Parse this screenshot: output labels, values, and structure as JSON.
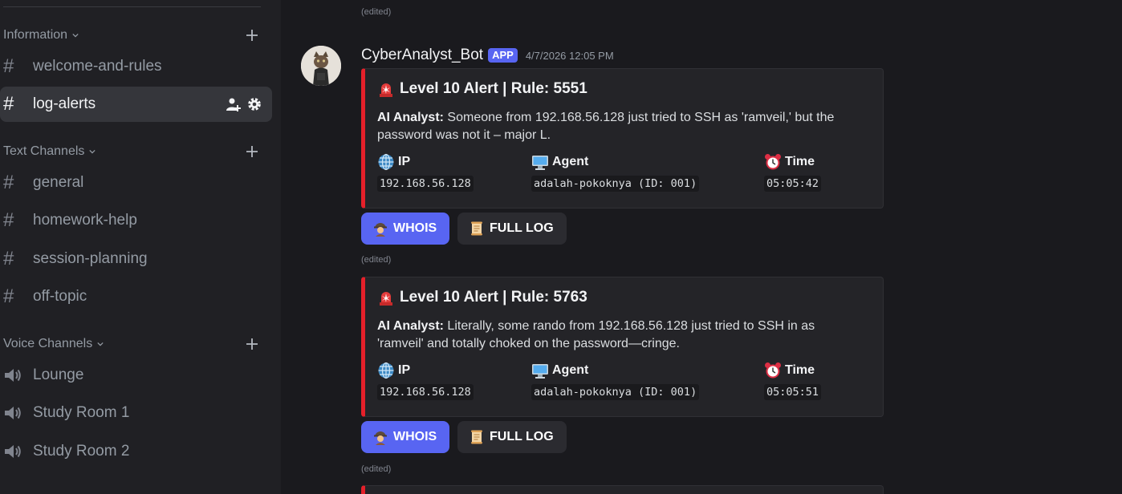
{
  "sidebar": {
    "categories": [
      {
        "label": "Information"
      },
      {
        "label": "Text Channels"
      },
      {
        "label": "Voice Channels"
      }
    ],
    "channels": [
      {
        "label": "welcome-and-rules"
      },
      {
        "label": "log-alerts"
      },
      {
        "label": "general"
      },
      {
        "label": "homework-help"
      },
      {
        "label": "session-planning"
      },
      {
        "label": "off-topic"
      }
    ],
    "voice": [
      {
        "label": "Lounge"
      },
      {
        "label": "Study Room 1"
      },
      {
        "label": "Study Room 2"
      }
    ]
  },
  "message": {
    "edited_label": "(edited)",
    "username": "CyberAnalyst_Bot",
    "badge": "APP",
    "timestamp": "4/7/2026 12:05 PM"
  },
  "embeds": [
    {
      "title": "Level 10 Alert | Rule: 5551",
      "analyst_label": "AI Analyst:",
      "analyst_text": " Someone from 192.168.56.128 just tried to SSH as 'ramveil,' but the password was not it – major L.",
      "fields": [
        {
          "name": "IP",
          "value": "192.168.56.128",
          "icon": "globe-icon"
        },
        {
          "name": "Agent",
          "value": "adalah-pokoknya (ID: 001)",
          "icon": "computer-icon"
        },
        {
          "name": "Time",
          "value": "05:05:42",
          "icon": "alarm-clock-icon"
        }
      ],
      "buttons": {
        "whois": "WHOIS",
        "full_log": "FULL LOG"
      }
    },
    {
      "title": "Level 10 Alert | Rule: 5763",
      "analyst_label": "AI Analyst:",
      "analyst_text": " Literally, some rando from 192.168.56.128 just tried to SSH in as 'ramveil' and totally choked on the password—cringe.",
      "fields": [
        {
          "name": "IP",
          "value": "192.168.56.128",
          "icon": "globe-icon"
        },
        {
          "name": "Agent",
          "value": "adalah-pokoknya (ID: 001)",
          "icon": "computer-icon"
        },
        {
          "name": "Time",
          "value": "05:05:51",
          "icon": "alarm-clock-icon"
        }
      ],
      "buttons": {
        "whois": "WHOIS",
        "full_log": "FULL LOG"
      }
    }
  ],
  "colors": {
    "accent": "#5865f2",
    "alert_bar": "#e5202a",
    "sidebar_bg": "#202024",
    "main_bg": "#1a1a1e"
  }
}
